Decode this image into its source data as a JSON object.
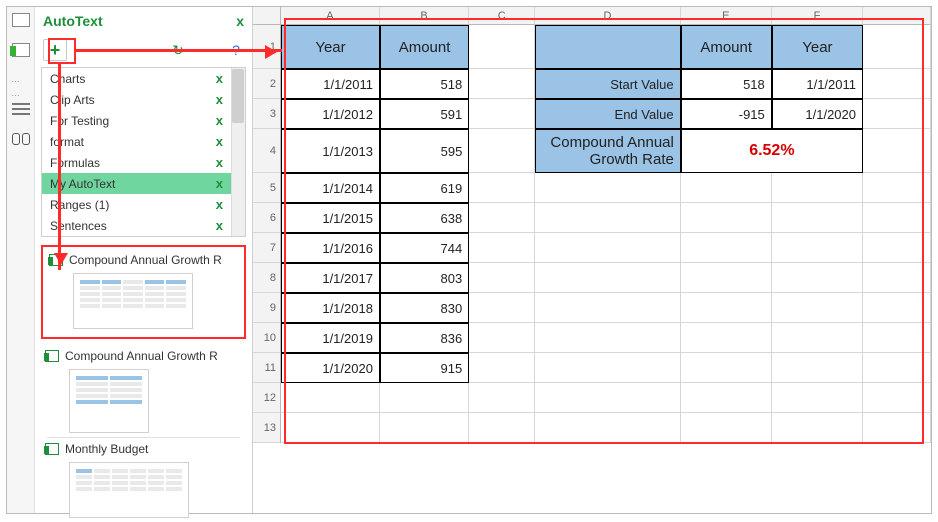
{
  "pane": {
    "title": "AutoText",
    "close_glyph": "x",
    "toolbar": {
      "plus_glyph": "+",
      "refresh_glyph": "↻",
      "help_glyph": "?"
    },
    "categories": [
      {
        "label": "Charts"
      },
      {
        "label": "Clip Arts"
      },
      {
        "label": "For Testing"
      },
      {
        "label": "format"
      },
      {
        "label": "Formulas"
      },
      {
        "label": "My AutoText",
        "selected": true
      },
      {
        "label": "Ranges (1)"
      },
      {
        "label": "Sentences"
      }
    ],
    "cat_close_glyph": "x",
    "entries_highlighted": [
      {
        "label": "Compound Annual Growth R"
      }
    ],
    "entries": [
      {
        "label": "Compound Annual Growth R"
      },
      {
        "label": "Monthly Budget"
      }
    ]
  },
  "sheet": {
    "cols": [
      "A",
      "B",
      "C",
      "D",
      "E",
      "F"
    ],
    "headers": {
      "A": "Year",
      "B": "Amount",
      "E": "Amount",
      "F": "Year"
    },
    "rows": [
      {
        "A": "1/1/2011",
        "B": "518"
      },
      {
        "A": "1/1/2012",
        "B": "591"
      },
      {
        "A": "1/1/2013",
        "B": "595"
      },
      {
        "A": "1/1/2014",
        "B": "619"
      },
      {
        "A": "1/1/2015",
        "B": "638"
      },
      {
        "A": "1/1/2016",
        "B": "744"
      },
      {
        "A": "1/1/2017",
        "B": "803"
      },
      {
        "A": "1/1/2018",
        "B": "830"
      },
      {
        "A": "1/1/2019",
        "B": "836"
      },
      {
        "A": "1/1/2020",
        "B": "915"
      }
    ],
    "summary": {
      "start_label": "Start Value",
      "start_amount": "518",
      "start_year": "1/1/2011",
      "end_label": "End Value",
      "end_amount": "-915",
      "end_year": "1/1/2020",
      "cagr_label": "Compound Annual Growth Rate",
      "cagr_value": "6.52%"
    }
  }
}
